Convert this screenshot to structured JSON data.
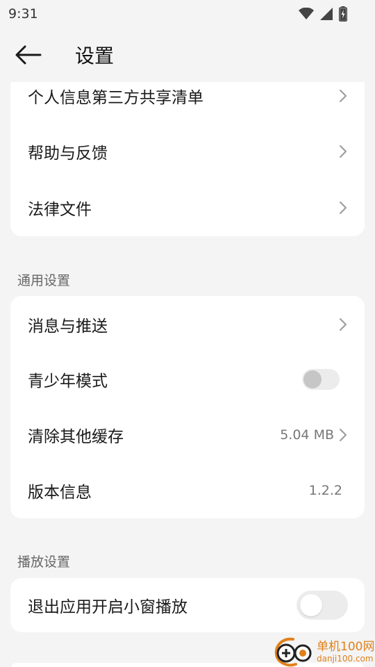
{
  "status_bar": {
    "time": "9:31",
    "icons": [
      "wifi-icon",
      "signal-icon",
      "battery-charging-icon"
    ]
  },
  "app_bar": {
    "back_icon": "arrow-left-icon",
    "title": "设置"
  },
  "card_top": {
    "items": [
      {
        "label": "个人信息第三方共享清单"
      },
      {
        "label": "帮助与反馈"
      },
      {
        "label": "法律文件"
      }
    ]
  },
  "general": {
    "header": "通用设置",
    "items": [
      {
        "label": "消息与推送"
      },
      {
        "label": "青少年模式",
        "toggle_on": false
      },
      {
        "label": "清除其他缓存",
        "value": "5.04 MB"
      },
      {
        "label": "版本信息",
        "value": "1.2.2"
      }
    ]
  },
  "playback": {
    "header": "播放设置",
    "items": [
      {
        "label": "退出应用开启小窗播放",
        "toggle_on": false
      }
    ]
  },
  "watermark": {
    "title": "单机100网",
    "subtitle": "danji100.com"
  },
  "colors": {
    "background": "#f4f4f4",
    "card": "#ffffff",
    "watermark": "#e0801a"
  }
}
